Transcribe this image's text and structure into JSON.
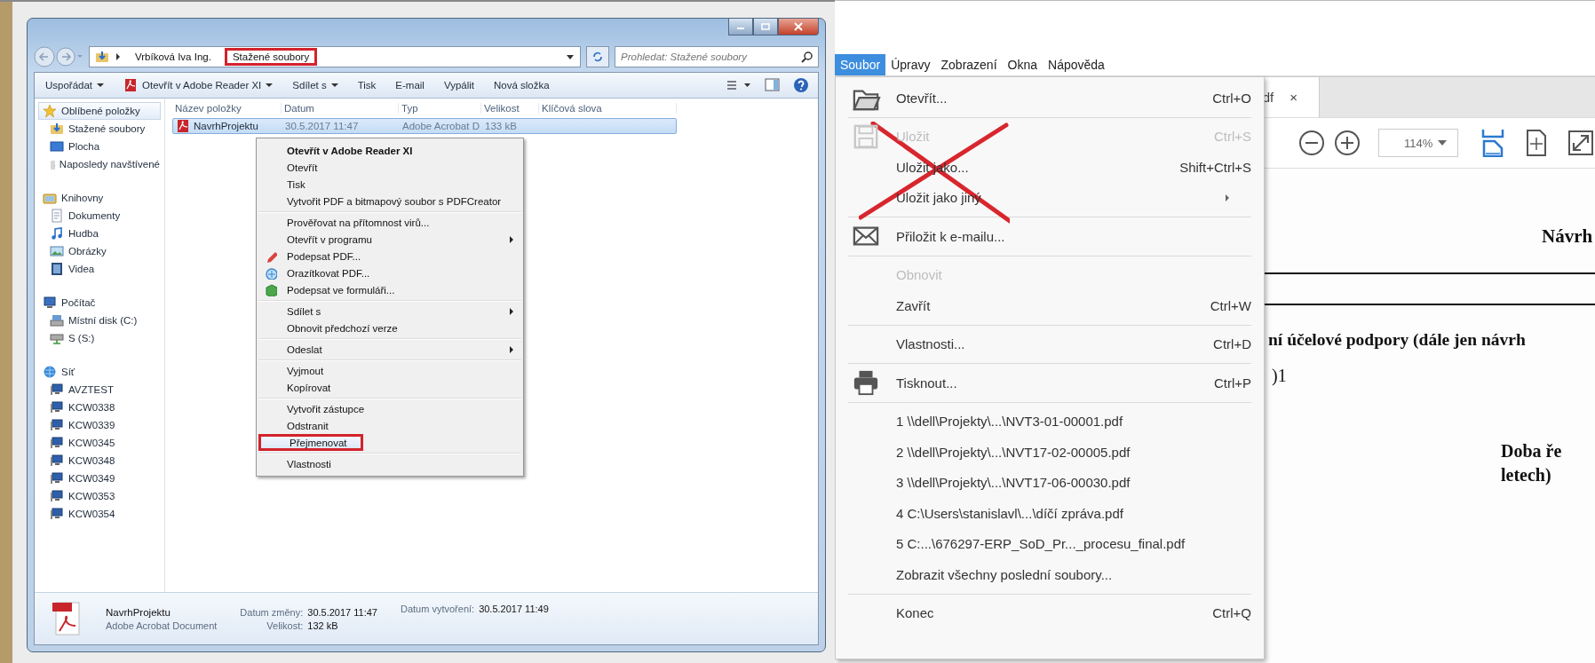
{
  "explorer": {
    "breadcrumb": [
      {
        "label": "Vrbíková Iva Ing.",
        "highlighted": false
      },
      {
        "label": "Stažené soubory",
        "highlighted": true
      }
    ],
    "search": {
      "placeholder": "Prohledat: Stažené soubory"
    },
    "toolbar": [
      {
        "label": "Uspořádat",
        "dropdown": true
      },
      {
        "label": "Otevřít v Adobe Reader XI",
        "dropdown": true
      },
      {
        "label": "Sdílet s",
        "dropdown": true
      },
      {
        "label": "Tisk",
        "dropdown": false
      },
      {
        "label": "E-mail",
        "dropdown": false
      },
      {
        "label": "Vypálit",
        "dropdown": false
      },
      {
        "label": "Nová složka",
        "dropdown": false
      }
    ],
    "sidebar": [
      {
        "label": "Oblíbené položky",
        "selected": true,
        "children": [
          {
            "label": "Stažené soubory",
            "selected": false
          },
          {
            "label": "Plocha",
            "selected": false
          },
          {
            "label": "Naposledy navštívené",
            "selected": false
          }
        ]
      },
      {
        "label": "Knihovny",
        "selected": false,
        "children": [
          {
            "label": "Dokumenty",
            "selected": false
          },
          {
            "label": "Hudba",
            "selected": false
          },
          {
            "label": "Obrázky",
            "selected": false
          },
          {
            "label": "Videa",
            "selected": false
          }
        ]
      },
      {
        "label": "Počítač",
        "selected": false,
        "children": [
          {
            "label": "Místní disk (C:)",
            "selected": false
          },
          {
            "label": "S (S:)",
            "selected": false
          }
        ]
      },
      {
        "label": "Síť",
        "selected": false,
        "children": [
          {
            "label": "AVZTEST",
            "selected": false
          },
          {
            "label": "KCW0338",
            "selected": false
          },
          {
            "label": "KCW0339",
            "selected": false
          },
          {
            "label": "KCW0345",
            "selected": false
          },
          {
            "label": "KCW0348",
            "selected": false
          },
          {
            "label": "KCW0349",
            "selected": false
          },
          {
            "label": "KCW0353",
            "selected": false
          },
          {
            "label": "KCW0354",
            "selected": false
          }
        ]
      }
    ],
    "columns": [
      "Název položky",
      "Datum",
      "Typ",
      "Velikost",
      "Klíčová slova"
    ],
    "rows": [
      {
        "name": "NavrhProjektu",
        "date": "30.5.2017 11:47",
        "type": "Adobe Acrobat D",
        "size": "133 kB",
        "selected": true
      }
    ],
    "context_menu": [
      {
        "items": [
          {
            "label": "Otevřít v Adobe Reader XI",
            "default": true
          },
          {
            "label": "Otevřít"
          },
          {
            "label": "Tisk"
          },
          {
            "label": "Vytvořit PDF a bitmapový soubor s PDFCreator"
          }
        ]
      },
      {
        "items": [
          {
            "label": "Prověřovat na přítomnost virů..."
          },
          {
            "label": "Otevřít v programu",
            "submenu": true
          },
          {
            "label": "Podepsat PDF..."
          },
          {
            "label": "Orazítkovat PDF..."
          },
          {
            "label": "Podepsat ve formuláři..."
          }
        ]
      },
      {
        "items": [
          {
            "label": "Sdílet s",
            "submenu": true
          },
          {
            "label": "Obnovit předchozí verze"
          }
        ]
      },
      {
        "items": [
          {
            "label": "Odeslat",
            "submenu": true
          }
        ]
      },
      {
        "items": [
          {
            "label": "Vyjmout"
          },
          {
            "label": "Kopírovat"
          }
        ]
      },
      {
        "items": [
          {
            "label": "Vytvořit zástupce"
          },
          {
            "label": "Odstranit"
          },
          {
            "label": "Přejmenovat",
            "highlighted": true
          }
        ]
      },
      {
        "items": [
          {
            "label": "Vlastnosti"
          }
        ]
      }
    ],
    "details": {
      "name": "NavrhProjektu",
      "type": "Adobe Acrobat Document",
      "field_groups": [
        {
          "fields": [
            {
              "label": "Datum změny:",
              "value": "30.5.2017 11:47"
            },
            {
              "label": "Velikost:",
              "value": "132 kB"
            }
          ]
        },
        {
          "fields": [
            {
              "label": "Datum vytvoření:",
              "value": "30.5.2017 11:49"
            }
          ]
        }
      ]
    }
  },
  "reader": {
    "menubar": [
      {
        "label": "Soubor",
        "selected": true
      },
      {
        "label": "Úpravy",
        "selected": false
      },
      {
        "label": "Zobrazení",
        "selected": false
      },
      {
        "label": "Okna",
        "selected": false
      },
      {
        "label": "Nápověda",
        "selected": false
      }
    ],
    "file_menu": [
      {
        "items": [
          {
            "label": "Otevřít...",
            "shortcut": "Ctrl+O",
            "disabled": false
          }
        ]
      },
      {
        "crossed_out": true,
        "items": [
          {
            "label": "Uložit",
            "shortcut": "Ctrl+S",
            "disabled": true
          },
          {
            "label": "Uložit jako...",
            "shortcut": "Shift+Ctrl+S",
            "disabled": false
          },
          {
            "label": "Uložit jako jiný",
            "submenu": true,
            "disabled": false
          }
        ]
      },
      {
        "items": [
          {
            "label": "Přiložit k e-mailu...",
            "disabled": false
          }
        ]
      },
      {
        "items": [
          {
            "label": "Obnovit",
            "disabled": true
          },
          {
            "label": "Zavřít",
            "shortcut": "Ctrl+W",
            "disabled": false
          }
        ]
      },
      {
        "items": [
          {
            "label": "Vlastnosti...",
            "shortcut": "Ctrl+D",
            "disabled": false
          }
        ]
      },
      {
        "items": [
          {
            "label": "Tisknout...",
            "shortcut": "Ctrl+P",
            "disabled": false
          }
        ]
      },
      {
        "items": [
          {
            "label": "1 \\\\dell\\Projekty\\...\\NVT3-01-00001.pdf",
            "disabled": false
          },
          {
            "label": "2 \\\\dell\\Projekty\\...\\NVT17-02-00005.pdf",
            "disabled": false
          },
          {
            "label": "3 \\\\dell\\Projekty\\...\\NVT17-06-00030.pdf",
            "disabled": false
          },
          {
            "label": "4 C:\\Users\\stanislavl\\...\\díčí zpráva.pdf",
            "disabled": false
          },
          {
            "label": "5 C:...\\676297-ERP_SoD_Pr..._procesu_final.pdf",
            "disabled": false
          },
          {
            "label": "Zobrazit všechny poslední soubory...",
            "disabled": false
          }
        ]
      },
      {
        "items": [
          {
            "label": "Konec",
            "shortcut": "Ctrl+Q",
            "disabled": false
          }
        ]
      }
    ],
    "tab": {
      "label": "df",
      "close": "×"
    },
    "zoom": "114%",
    "document": [
      {
        "kind": "title",
        "text": "Návrh"
      },
      {
        "kind": "heading",
        "text": "ní účelové podpory (dále jen návrh"
      },
      {
        "kind": "body",
        "text": ")1"
      },
      {
        "kind": "side",
        "text": "Doba ře"
      },
      {
        "kind": "side2",
        "text": "letech)"
      }
    ]
  }
}
